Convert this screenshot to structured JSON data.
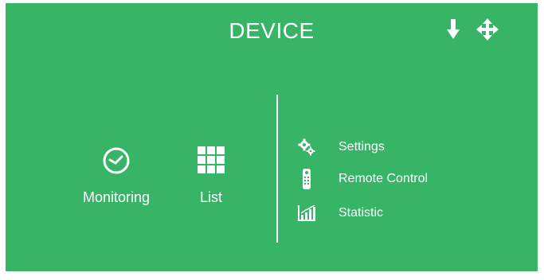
{
  "header": {
    "title": "DEVICE",
    "icons": [
      "download-icon",
      "move-icon"
    ]
  },
  "main": {
    "items": [
      {
        "label": "Monitoring",
        "icon": "clock-icon"
      },
      {
        "label": "List",
        "icon": "grid-icon"
      }
    ]
  },
  "menu": {
    "items": [
      {
        "label": "Settings",
        "icon": "gears-icon"
      },
      {
        "label": "Remote Control",
        "icon": "remote-icon"
      },
      {
        "label": "Statistic",
        "icon": "bar-chart-icon"
      }
    ]
  },
  "colors": {
    "background": "#38b467",
    "foreground": "#ffffff"
  }
}
